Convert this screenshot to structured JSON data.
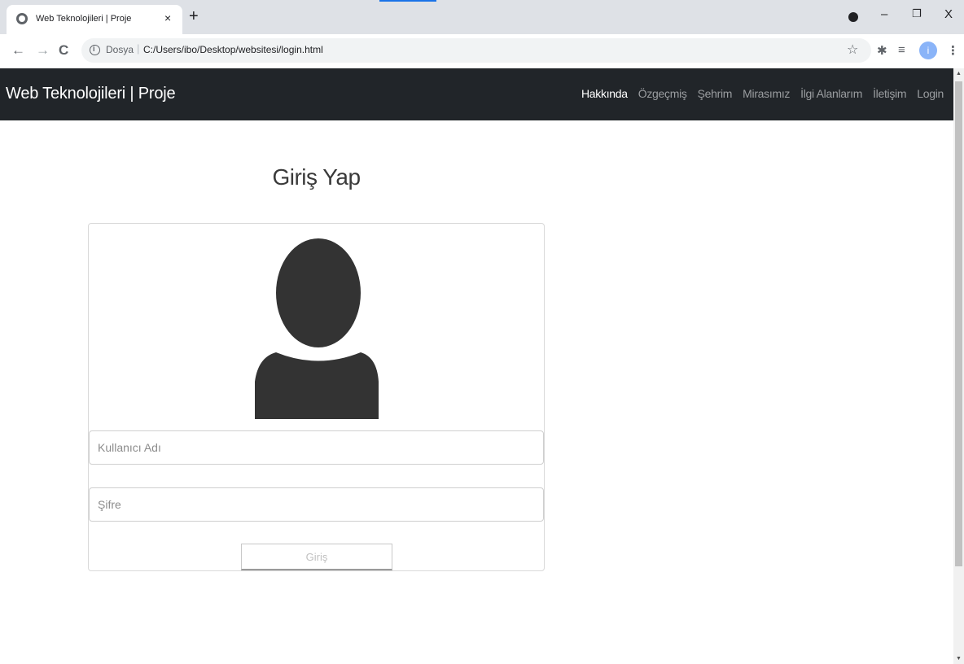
{
  "browser": {
    "tab_title": "Web Teknolojileri | Proje",
    "tab_close": "×",
    "new_tab": "+",
    "window_controls": {
      "minimize": "–",
      "restore": "❐",
      "close": "X"
    },
    "back": "←",
    "forward": "→",
    "reload": "C",
    "scheme_label": "Dosya",
    "url_separator": "|",
    "url": "C:/Users/ibo/Desktop/websitesi/login.html",
    "bookmark_star": "☆",
    "extensions_icon": "✱",
    "reading_list_icon": "≡",
    "profile_initial": "i",
    "menu_icon": "⋮"
  },
  "navbar": {
    "brand": "Web Teknolojileri | Proje",
    "links": [
      {
        "label": "Hakkında",
        "active": true
      },
      {
        "label": "Özgeçmiş",
        "active": false
      },
      {
        "label": "Şehrim",
        "active": false
      },
      {
        "label": "Mirasımız",
        "active": false
      },
      {
        "label": "İlgi Alanlarım",
        "active": false
      },
      {
        "label": "İletişim",
        "active": false
      },
      {
        "label": "Login",
        "active": false
      }
    ]
  },
  "login": {
    "title": "Giriş Yap",
    "avatar_icon": "user-avatar-icon",
    "username_placeholder": "Kullanıcı Adı",
    "password_placeholder": "Şifre",
    "submit_label": "Giriş"
  },
  "colors": {
    "navbar_bg": "#212529",
    "avatar_fill": "#333333",
    "accent": "#1a73e8"
  }
}
